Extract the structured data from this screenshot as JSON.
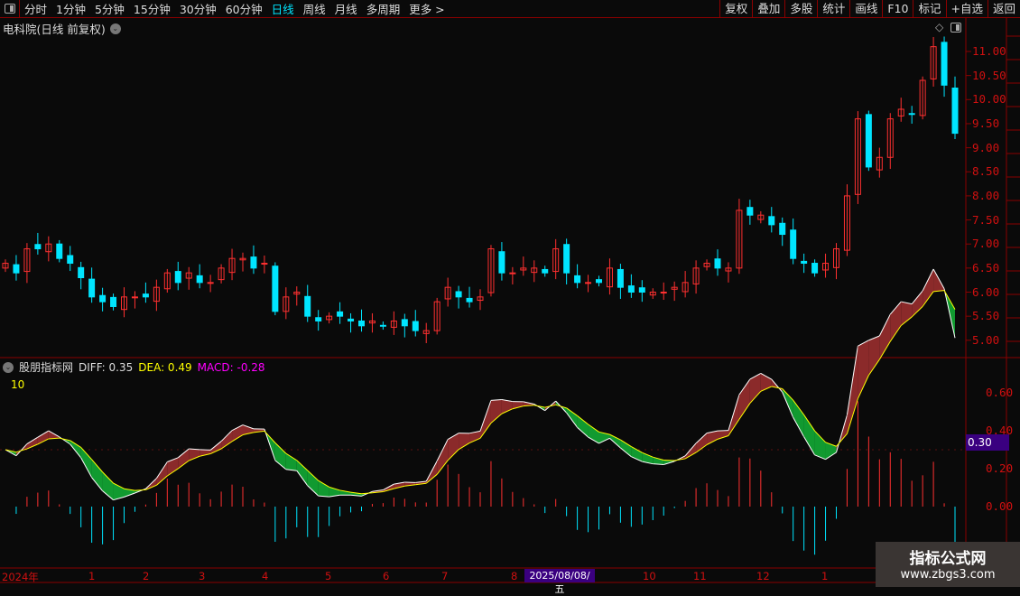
{
  "toolbar": {
    "periods": [
      "分时",
      "1分钟",
      "5分钟",
      "15分钟",
      "30分钟",
      "60分钟",
      "日线",
      "周线",
      "月线",
      "多周期",
      "更多 >"
    ],
    "active_period": "日线",
    "right_tools": [
      "复权",
      "叠加",
      "多股",
      "统计",
      "画线",
      "F10",
      "标记",
      "+自选",
      "返回"
    ]
  },
  "stock": {
    "title": "电科院(日线 前复权)"
  },
  "price_axis": {
    "ticks": [
      "11.00",
      "10.50",
      "10.00",
      "9.50",
      "9.00",
      "8.50",
      "8.00",
      "7.50",
      "7.00",
      "6.50",
      "6.00",
      "5.50",
      "5.00"
    ]
  },
  "indicator": {
    "name": "股朋指标网",
    "diff": "DIFF: 0.35",
    "dea": "DEA: 0.49",
    "macd": "MACD: -0.28",
    "param": "10",
    "axis_ticks": [
      "0.60",
      "0.40",
      "0.20",
      "0.00"
    ],
    "current_value": "0.30"
  },
  "date_axis": {
    "labels": [
      "2024年",
      "1",
      "2",
      "3",
      "4",
      "5",
      "6",
      "7",
      "8",
      "10",
      "11",
      "12",
      "1"
    ],
    "cursor_date": "2025/08/08/五"
  },
  "colors": {
    "up": "#ff3030",
    "down": "#00e5ff",
    "diff_above": "#8b2a2a",
    "diff_below": "#119a30",
    "axis": "#d01010",
    "accent": "#3a0080"
  },
  "chart_data": {
    "type": "candlestick",
    "price_range": [
      5.0,
      11.0
    ],
    "closes": [
      6.6,
      6.4,
      6.9,
      6.9,
      7.0,
      6.7,
      6.6,
      6.3,
      5.9,
      5.8,
      5.7,
      5.9,
      5.9,
      5.9,
      6.1,
      6.4,
      6.2,
      6.4,
      6.2,
      6.2,
      6.5,
      6.7,
      6.7,
      6.5,
      6.6,
      5.6,
      5.9,
      6.0,
      5.5,
      5.4,
      5.5,
      5.5,
      5.4,
      5.3,
      5.4,
      5.3,
      5.4,
      5.3,
      5.2,
      5.2,
      5.8,
      6.1,
      5.9,
      5.8,
      5.9,
      6.9,
      6.4,
      6.4,
      6.5,
      6.5,
      6.4,
      6.9,
      6.4,
      6.2,
      6.2,
      6.2,
      6.5,
      6.1,
      6.0,
      6.0,
      6.0,
      6.0,
      6.1,
      6.2,
      6.5,
      6.6,
      6.5,
      6.5,
      7.7,
      7.6,
      7.6,
      7.4,
      7.2,
      6.7,
      6.6,
      6.4,
      6.6,
      6.9,
      8.0,
      9.6,
      8.6,
      8.8,
      9.6,
      9.8,
      9.7,
      10.4,
      11.1,
      10.3,
      9.3
    ]
  },
  "watermark": {
    "line1": "指标公式网",
    "line2": "www.zbgs3.com"
  }
}
